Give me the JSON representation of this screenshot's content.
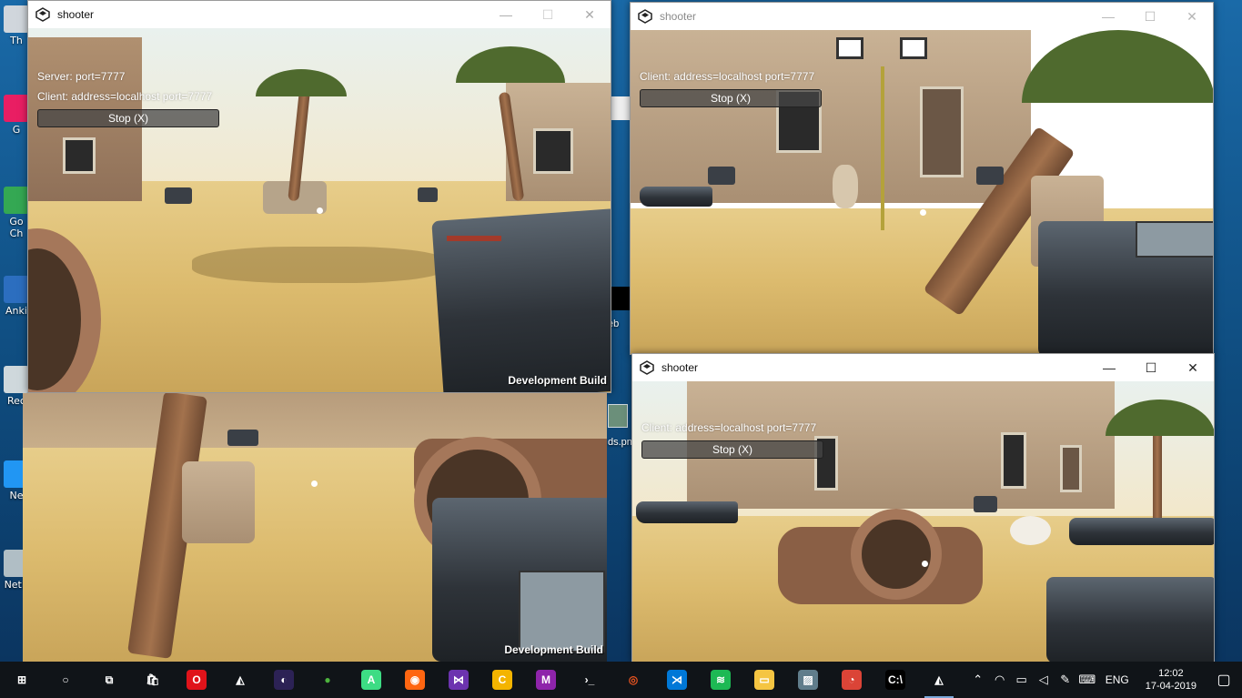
{
  "desktop": {
    "icons": [
      {
        "label": "Th",
        "color": "#d0d6dc"
      },
      {
        "label": "G",
        "color": "#e91e63"
      },
      {
        "label": "Go\nCh",
        "color": "#34a853"
      },
      {
        "label": "Anki",
        "color": "#2c6ebf"
      },
      {
        "label": "Rec",
        "color": "#cfd8dc"
      },
      {
        "label": "Ne",
        "color": "#2196f3"
      },
      {
        "label": "NetB",
        "color": "#b0bec5"
      }
    ],
    "partial_labels": {
      "eb": "eb",
      "ds_png": "ds.pn"
    }
  },
  "windows": {
    "w1": {
      "hud_lines": [
        "Server: port=7777",
        "Client: address=localhost port=7777"
      ],
      "stop_label": "Stop (X)",
      "devbuild": "Development Build",
      "title": "shooter"
    },
    "w2": {
      "title": "shooter",
      "hud_lines": [
        "Client: address=localhost port=7777"
      ],
      "stop_label": "Stop (X)"
    },
    "w3": {
      "devbuild": "Development Build"
    },
    "w4": {
      "title": "shooter",
      "hud_lines": [
        "Client: address=localhost port=7777"
      ],
      "stop_label": "Stop (X)"
    }
  },
  "window_controls": {
    "minimize": "—",
    "maximize": "☐",
    "close": "✕"
  },
  "taskbar": {
    "items": [
      {
        "name": "start-button",
        "glyph": "⊞",
        "color": "#ffffff",
        "bg": "transparent"
      },
      {
        "name": "search-button",
        "glyph": "○",
        "color": "#ffffff",
        "bg": "transparent"
      },
      {
        "name": "task-view-button",
        "glyph": "⧉",
        "color": "#ffffff",
        "bg": "transparent"
      },
      {
        "name": "store-app",
        "glyph": "🛍",
        "color": "#ffffff",
        "bg": "transparent"
      },
      {
        "name": "opera-app",
        "glyph": "O",
        "color": "#ffffff",
        "bg": "#e0131a"
      },
      {
        "name": "unity-app",
        "glyph": "◭",
        "color": "#ffffff",
        "bg": "transparent"
      },
      {
        "name": "eclipse-app",
        "glyph": "◐",
        "color": "#ffffff",
        "bg": "#2c2255"
      },
      {
        "name": "mongodb-app",
        "glyph": "●",
        "color": "#4db33d",
        "bg": "transparent"
      },
      {
        "name": "android-studio-app",
        "glyph": "A",
        "color": "#ffffff",
        "bg": "#3ddc84"
      },
      {
        "name": "firefox-app",
        "glyph": "◉",
        "color": "#ffffff",
        "bg": "#ff6611"
      },
      {
        "name": "visual-studio-app",
        "glyph": "⋈",
        "color": "#ffffff",
        "bg": "#6c33af"
      },
      {
        "name": "canary-app",
        "glyph": "C",
        "color": "#ffffff",
        "bg": "#f4b400"
      },
      {
        "name": "mathway-app",
        "glyph": "M",
        "color": "#ffffff",
        "bg": "#8e24aa"
      },
      {
        "name": "terminal-app",
        "glyph": "›_",
        "color": "#ffffff",
        "bg": "transparent"
      },
      {
        "name": "ubuntu-app",
        "glyph": "◎",
        "color": "#e95420",
        "bg": "transparent"
      },
      {
        "name": "vscode-app",
        "glyph": "⋊",
        "color": "#ffffff",
        "bg": "#0078d7"
      },
      {
        "name": "spotify-app",
        "glyph": "≋",
        "color": "#ffffff",
        "bg": "#1db954"
      },
      {
        "name": "file-explorer-app",
        "glyph": "▭",
        "color": "#ffffff",
        "bg": "#f5c542"
      },
      {
        "name": "photos-app",
        "glyph": "▨",
        "color": "#ffffff",
        "bg": "#607d8b"
      },
      {
        "name": "chrome-app",
        "glyph": "◔",
        "color": "#ffffff",
        "bg": "#db4437"
      },
      {
        "name": "cmd-app",
        "glyph": "C:\\",
        "color": "#ffffff",
        "bg": "#000000"
      },
      {
        "name": "unity-running-app",
        "glyph": "◭",
        "color": "#ffffff",
        "bg": "transparent",
        "active": true
      }
    ],
    "tray": {
      "icons": [
        {
          "name": "chevron-up-icon",
          "glyph": "⌃"
        },
        {
          "name": "wifi-icon",
          "glyph": "◠"
        },
        {
          "name": "battery-icon",
          "glyph": "▭"
        },
        {
          "name": "volume-icon",
          "glyph": "◁"
        },
        {
          "name": "pen-icon",
          "glyph": "✎"
        },
        {
          "name": "keyboard-icon",
          "glyph": "⌨"
        }
      ],
      "language": "ENG",
      "time": "12:02",
      "date": "17-04-2019",
      "notification_glyph": "▢"
    }
  }
}
